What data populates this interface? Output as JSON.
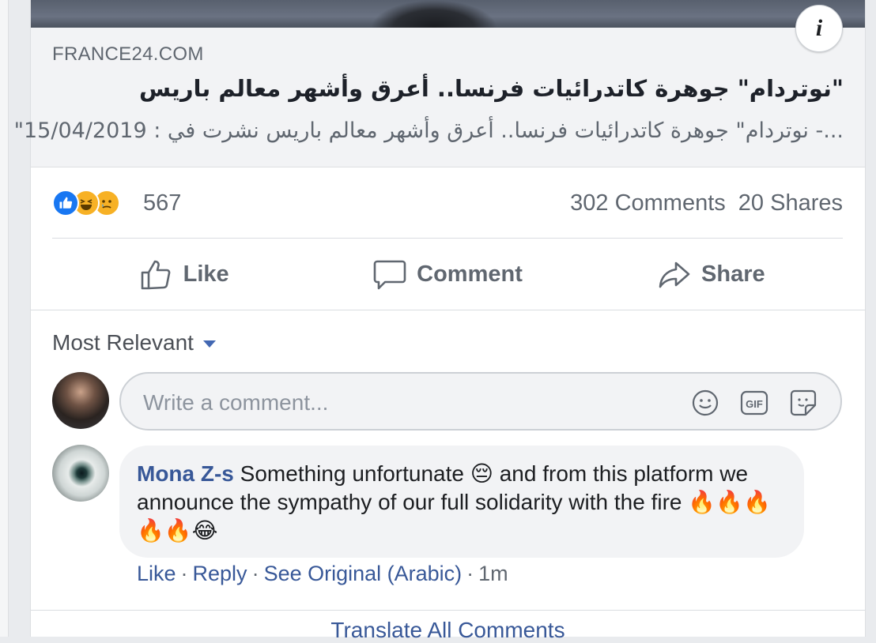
{
  "link_preview": {
    "domain": "FRANCE24.COM",
    "title": "\"نوتردام\" جوهرة كاتدرائيات فرنسا.. أعرق وأشهر معالم باريس",
    "description": "...- نوتردام\" جوهرة كاتدرائيات فرنسا.. أعرق وأشهر معالم باريس نشرت في : 15/04/2019\"",
    "info_icon": "i"
  },
  "stats": {
    "reaction_icons": [
      "like-reaction-icon",
      "haha-reaction-icon",
      "sad-reaction-icon"
    ],
    "reaction_count": "567",
    "comments": "302 Comments",
    "shares": "20 Shares"
  },
  "actions": {
    "like": "Like",
    "comment": "Comment",
    "share": "Share"
  },
  "comments_section": {
    "sort_label": "Most Relevant",
    "composer_placeholder": "Write a comment...",
    "gif_label": "GIF"
  },
  "comment": {
    "author": "Mona Z-s",
    "text": "Something unfortunate 😔 and from this platform we announce the sympathy of our full solidarity with the fire 🔥🔥🔥🔥🔥😂",
    "like": "Like",
    "reply": "Reply",
    "see_original": "See Original (Arabic)",
    "time": "1m"
  },
  "footer": {
    "translate_all": "Translate All Comments"
  },
  "colors": {
    "link_blue": "#385898",
    "like_blue": "#1877f2",
    "muted_text": "#606770",
    "bubble_bg": "#f2f3f5"
  }
}
